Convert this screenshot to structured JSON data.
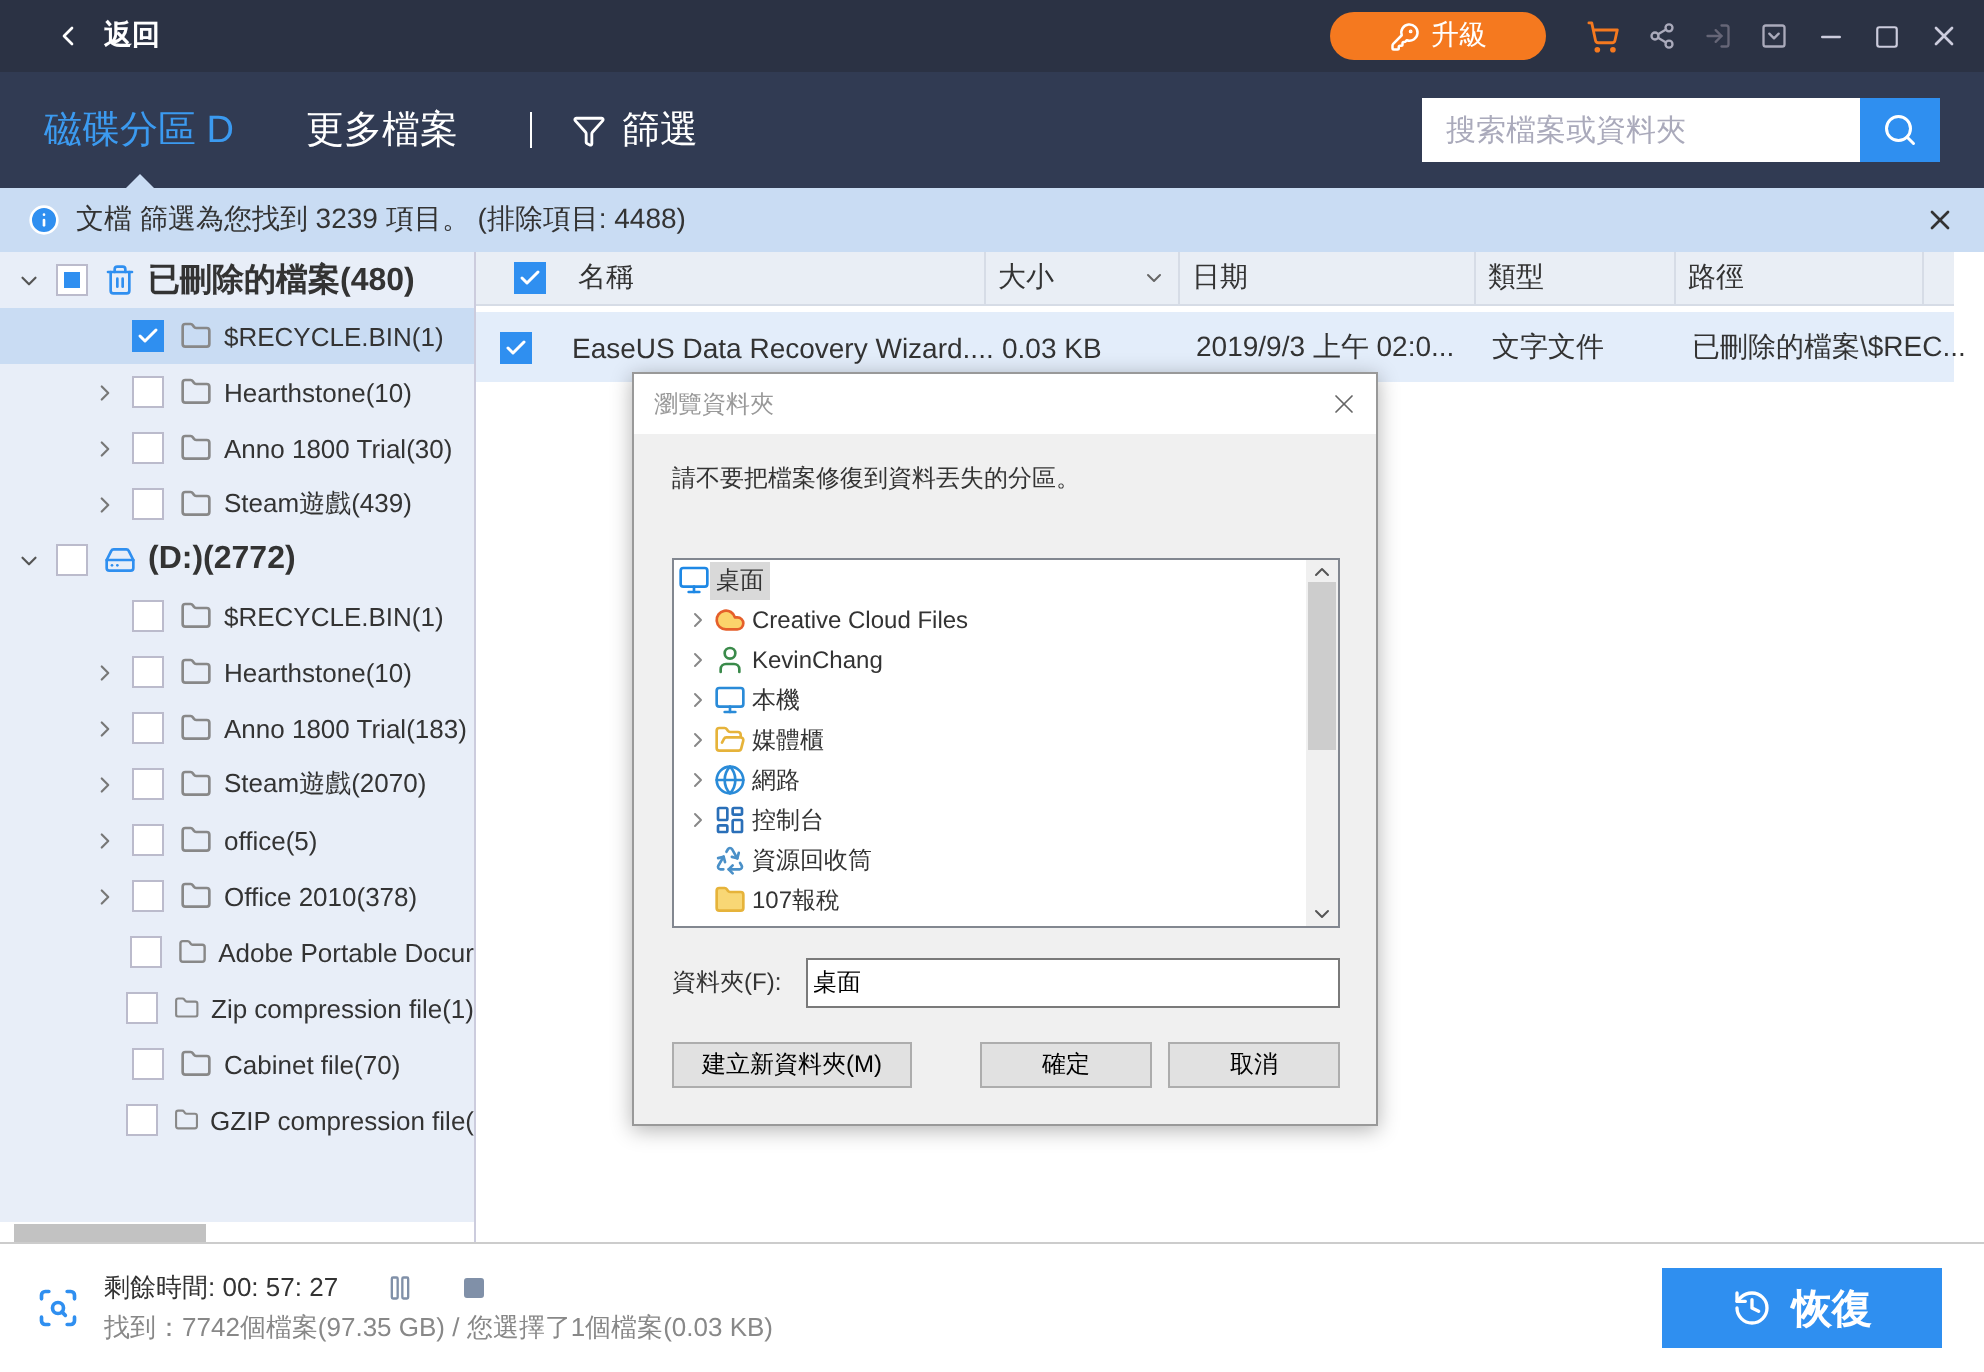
{
  "title_bar": {
    "back": "返回",
    "upgrade": "升級"
  },
  "nav": {
    "tabs": [
      {
        "label": "磁碟分區 D",
        "selected": true
      },
      {
        "label": "更多檔案",
        "selected": false
      }
    ],
    "filter": "篩選",
    "search": {
      "placeholder": "搜索檔案或資料夾"
    }
  },
  "info_bar": {
    "text": "文檔 篩選為您找到 3239 項目。 (排除項目: 4488)"
  },
  "tree": [
    {
      "label": "已刪除的檔案(480)",
      "kind": "trash",
      "checked": false,
      "partial": true,
      "expanded": true,
      "selected": false,
      "children": [
        {
          "label": "$RECYCLE.BIN(1)",
          "kind": "folder",
          "checked": true,
          "expandable": false,
          "selected": true
        },
        {
          "label": "Hearthstone(10)",
          "kind": "folder",
          "checked": false,
          "expandable": true,
          "selected": false
        },
        {
          "label": "Anno 1800 Trial(30)",
          "kind": "folder",
          "checked": false,
          "expandable": true,
          "selected": false
        },
        {
          "label": "Steam遊戲(439)",
          "kind": "folder",
          "checked": false,
          "expandable": true,
          "selected": false
        }
      ]
    },
    {
      "label": "(D:)(2772)",
      "kind": "drive",
      "checked": false,
      "partial": false,
      "expanded": true,
      "selected": false,
      "children": [
        {
          "label": "$RECYCLE.BIN(1)",
          "kind": "folder",
          "checked": false,
          "expandable": false,
          "selected": false
        },
        {
          "label": "Hearthstone(10)",
          "kind": "folder",
          "checked": false,
          "expandable": true,
          "selected": false
        },
        {
          "label": "Anno 1800 Trial(183)",
          "kind": "folder",
          "checked": false,
          "expandable": true,
          "selected": false
        },
        {
          "label": "Steam遊戲(2070)",
          "kind": "folder",
          "checked": false,
          "expandable": true,
          "selected": false
        },
        {
          "label": "office(5)",
          "kind": "folder",
          "checked": false,
          "expandable": true,
          "selected": false
        },
        {
          "label": "Office 2010(378)",
          "kind": "folder",
          "checked": false,
          "expandable": true,
          "selected": false
        },
        {
          "label": "Adobe Portable Docur",
          "kind": "folder",
          "checked": false,
          "expandable": false,
          "selected": false
        },
        {
          "label": "Zip compression file(1)",
          "kind": "folder",
          "checked": false,
          "expandable": false,
          "selected": false
        },
        {
          "label": "Cabinet file(70)",
          "kind": "folder",
          "checked": false,
          "expandable": false,
          "selected": false
        },
        {
          "label": "GZIP compression file(",
          "kind": "folder",
          "checked": false,
          "expandable": false,
          "selected": false
        }
      ]
    }
  ],
  "table": {
    "all_checked": true,
    "columns": [
      "名稱",
      "大小",
      "日期",
      "類型",
      "路徑"
    ],
    "rows": [
      {
        "checked": true,
        "selected": true,
        "cells": [
          "EaseUS Data Recovery Wizard....",
          "0.03 KB",
          "2019/9/3 上午 02:0...",
          "文字文件",
          "已刪除的檔案\\$REC..."
        ]
      }
    ]
  },
  "dialog": {
    "title": "瀏覽資料夾",
    "message": "請不要把檔案修復到資料丟失的分區。",
    "items": [
      {
        "label": "桌面",
        "kind": "desktop",
        "selected": true,
        "children": [
          {
            "label": "Creative Cloud Files",
            "kind": "cloud",
            "expandable": true,
            "selected": false
          },
          {
            "label": "KevinChang",
            "kind": "user",
            "expandable": true,
            "selected": false
          },
          {
            "label": "本機",
            "kind": "computer",
            "expandable": true,
            "selected": false
          },
          {
            "label": "媒體櫃",
            "kind": "library",
            "expandable": true,
            "selected": false
          },
          {
            "label": "網路",
            "kind": "network",
            "expandable": true,
            "selected": false
          },
          {
            "label": "控制台",
            "kind": "control",
            "expandable": true,
            "selected": false
          },
          {
            "label": "資源回收筒",
            "kind": "recycle",
            "expandable": false,
            "selected": false
          },
          {
            "label": "107報稅",
            "kind": "folder",
            "expandable": false,
            "selected": false
          }
        ]
      }
    ],
    "folder_label": "資料夾(F):",
    "folder_value": "桌面",
    "buttons": [
      {
        "label": "建立新資料夾(M)",
        "kind": "new"
      },
      {
        "label": "確定",
        "kind": "ok"
      },
      {
        "label": "取消",
        "kind": "cancel"
      }
    ]
  },
  "status": {
    "remaining": "剩餘時間: 00: 57: 27",
    "found": "找到：7742個檔案(97.35 GB) / 您選擇了1個檔案(0.03 KB)",
    "recover": "恢復"
  }
}
